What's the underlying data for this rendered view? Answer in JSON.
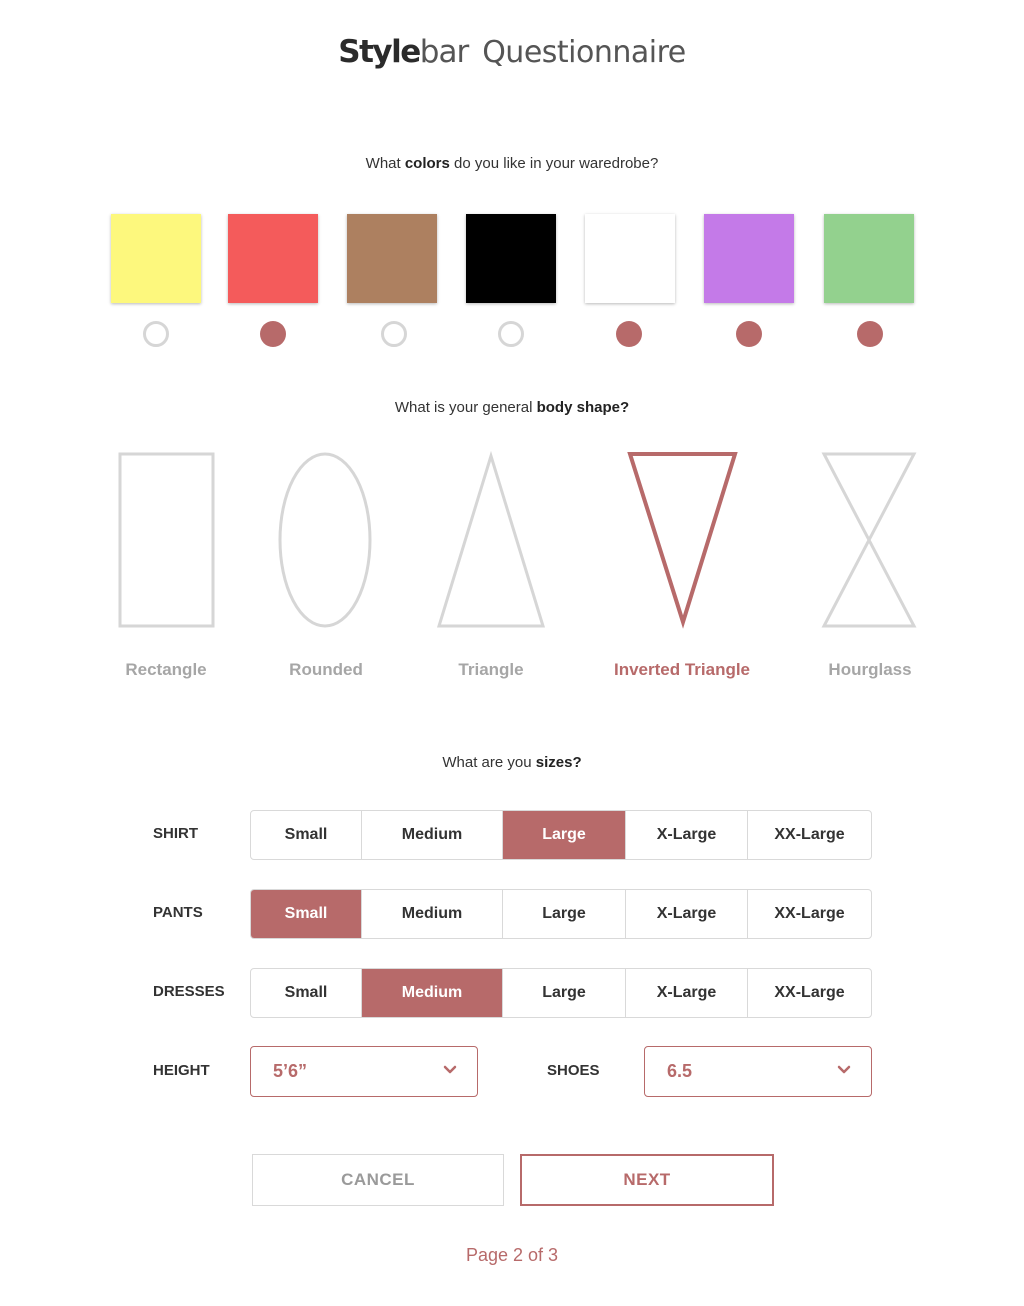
{
  "header": {
    "brand_bold": "Style",
    "brand_light": "bar",
    "title": "Questionnaire"
  },
  "colors": {
    "question_prefix": "What ",
    "question_bold": "colors",
    "question_suffix": " do you like in your waredrobe?",
    "swatches": [
      {
        "name": "yellow",
        "hex": "#fdf87d",
        "selected": false
      },
      {
        "name": "red",
        "hex": "#f45b5b",
        "selected": true
      },
      {
        "name": "brown",
        "hex": "#ad8060",
        "selected": false
      },
      {
        "name": "black",
        "hex": "#000000",
        "selected": false
      },
      {
        "name": "white",
        "hex": "#ffffff",
        "selected": true
      },
      {
        "name": "purple",
        "hex": "#c47ae8",
        "selected": true
      },
      {
        "name": "green",
        "hex": "#93d18e",
        "selected": true
      }
    ]
  },
  "body_shape": {
    "question_prefix": "What is your general ",
    "question_bold": "body shape?",
    "options": [
      {
        "label": "Rectangle",
        "icon": "rectangle-shape-icon",
        "selected": false
      },
      {
        "label": "Rounded",
        "icon": "ellipse-shape-icon",
        "selected": false
      },
      {
        "label": "Triangle",
        "icon": "triangle-shape-icon",
        "selected": false
      },
      {
        "label": "Inverted Triangle",
        "icon": "inverted-triangle-shape-icon",
        "selected": true
      },
      {
        "label": "Hourglass",
        "icon": "hourglass-shape-icon",
        "selected": false
      }
    ]
  },
  "sizes": {
    "question_prefix": "What are you ",
    "question_bold": "sizes?",
    "options": [
      "Small",
      "Medium",
      "Large",
      "X-Large",
      "XX-Large"
    ],
    "rows": [
      {
        "label": "SHIRT",
        "selected": "Large"
      },
      {
        "label": "PANTS",
        "selected": "Small"
      },
      {
        "label": "DRESSES",
        "selected": "Medium"
      }
    ],
    "height": {
      "label": "HEIGHT",
      "value": "5’6”"
    },
    "shoes": {
      "label": "SHOES",
      "value": "6.5"
    }
  },
  "actions": {
    "cancel": "CANCEL",
    "next": "NEXT"
  },
  "pagination": "Page 2 of 3",
  "theme": {
    "accent": "#b76a6a",
    "muted": "#d6d6d6"
  }
}
